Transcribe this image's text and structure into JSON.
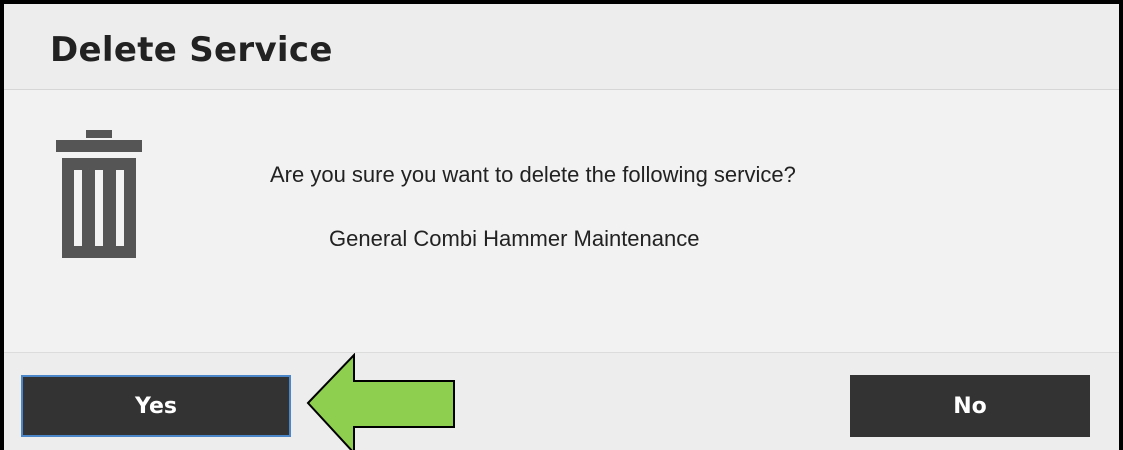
{
  "dialog": {
    "title": "Delete Service",
    "question": "Are you sure you want to delete the following service?",
    "service_name": "General Combi Hammer Maintenance",
    "icon": "trash-icon"
  },
  "buttons": {
    "yes_label": "Yes",
    "no_label": "No"
  },
  "colors": {
    "button_bg": "#333333",
    "focus_border": "#4a86c8",
    "arrow_fill": "#8fcf4f",
    "icon_color": "#555555"
  }
}
